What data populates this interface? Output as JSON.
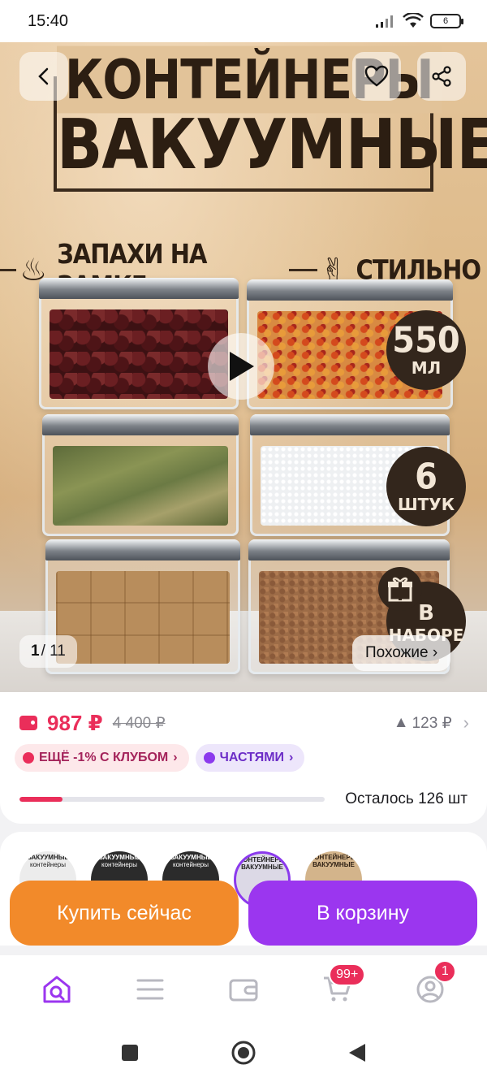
{
  "status_bar": {
    "time": "15:40",
    "battery": "6"
  },
  "hero": {
    "banner_line1": "КОНТЕЙНЕРЫ",
    "banner_line2": "ВАКУУМНЫЕ",
    "feature_1": "ЗАПАХИ НА ЗАМКЕ",
    "feature_2": "СТИЛЬНО",
    "badge_volume_value": "550",
    "badge_volume_unit": "МЛ",
    "badge_count_value": "6",
    "badge_count_unit": "ШТУК",
    "badge_set_line1": "В",
    "badge_set_line2": "НАБОРЕ",
    "image_index": "1",
    "image_total": "/ 11",
    "similar_label": "Похожие ›"
  },
  "price": {
    "current": "987 ₽",
    "old": "4 400 ₽",
    "diff": "123 ₽",
    "diff_arrow": "▲",
    "club_pill": "ЕЩЁ -1% С КЛУБОМ",
    "club_chevron": "›",
    "parts_pill": "ЧАСТЯМИ",
    "parts_chevron": "›",
    "stock_text": "Осталось 126 шт",
    "stock_fraction": 0.14
  },
  "variants": [
    {
      "top": "ВАКУУМНЫЕ",
      "bottom": "контейнеры"
    },
    {
      "top": "ВАКУУМНЫЕ",
      "bottom": "контейнеры"
    },
    {
      "top": "ВАКУУМНЫЕ",
      "bottom": "контейнеры"
    },
    {
      "top": "КОНТЕЙНЕРЫ",
      "bottom": "ВАКУУМНЫЕ"
    },
    {
      "top": "КОНТЕЙНЕРЫ",
      "bottom": "ВАКУУМНЫЕ"
    }
  ],
  "actions": {
    "buy_now": "Купить сейчас",
    "add_to_cart": "В корзину"
  },
  "bottom_nav": {
    "cart_badge": "99+",
    "profile_badge": "1"
  },
  "colors": {
    "accent_red": "#ea2e5a",
    "buy_orange": "#f28a2a",
    "cart_purple": "#9b36ef",
    "brand_purple": "#8b3aed"
  }
}
